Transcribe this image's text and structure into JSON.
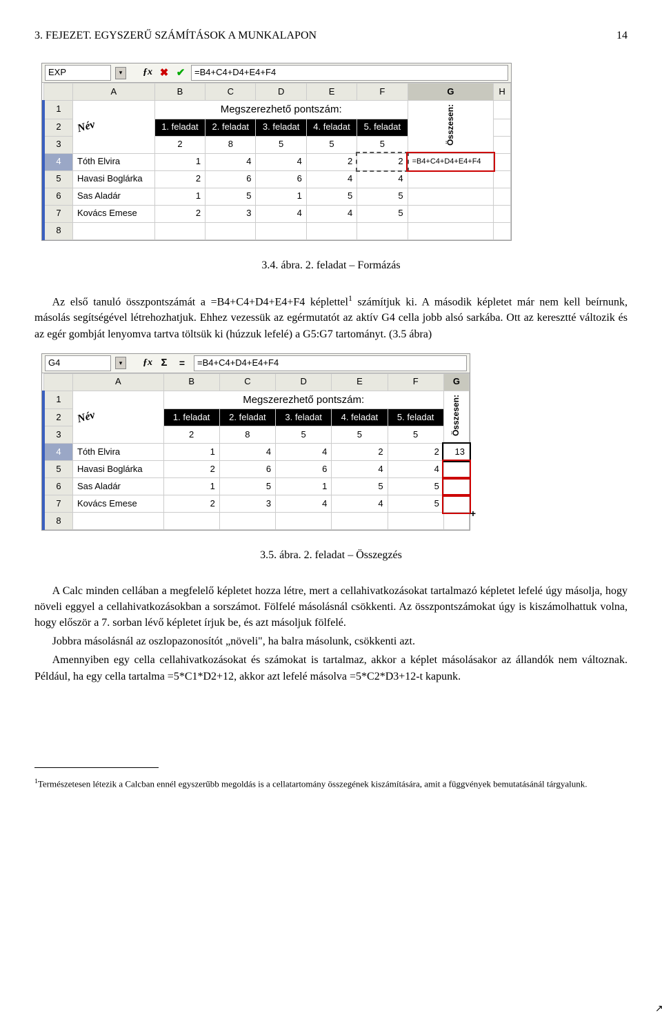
{
  "header": {
    "chapter": "3. FEJEZET. EGYSZERŰ SZÁMÍTÁSOK A MUNKALAPON",
    "page": "14"
  },
  "fig1": {
    "namebox": "EXP",
    "formula": "=B4+C4+D4+E4+F4",
    "cols": [
      "A",
      "B",
      "C",
      "D",
      "E",
      "F",
      "G",
      "H"
    ],
    "sel_col": "G",
    "rows": [
      "1",
      "2",
      "3",
      "4",
      "5",
      "6",
      "7",
      "8"
    ],
    "sel_row": "4",
    "title": "Megszerezhető pontszám:",
    "tasks": [
      "1. feladat",
      "2. feladat",
      "3. feladat",
      "4. feladat",
      "5. feladat"
    ],
    "ossz": "Összesen:",
    "nev": "Név",
    "max": [
      "2",
      "8",
      "5",
      "5",
      "5"
    ],
    "students": [
      {
        "name": "Tóth Elvira",
        "b": "1",
        "c": "4",
        "d": "4",
        "e": "2",
        "f": "2",
        "g": "=B4+C4+D4+E4+F4"
      },
      {
        "name": "Havasi Boglárka",
        "b": "2",
        "c": "6",
        "d": "6",
        "e": "4",
        "f": "4",
        "g": ""
      },
      {
        "name": "Sas Aladár",
        "b": "1",
        "c": "5",
        "d": "1",
        "e": "5",
        "f": "5",
        "g": ""
      },
      {
        "name": "Kovács Emese",
        "b": "2",
        "c": "3",
        "d": "4",
        "e": "4",
        "f": "5",
        "g": ""
      }
    ]
  },
  "cap1": "3.4. ábra. 2. feladat – Formázás",
  "para1a": "Az első tanuló összpontszámát a =B4+C4+D4+E4+F4 képlettel",
  "foot_mark": "1",
  "para1b": " számítjuk ki. A második képletet már nem kell beírnunk, másolás segítségével létrehozhatjuk. Ehhez vezessük az egérmutatót az aktív G4 cella jobb alsó sarkába. Ott az keresztté változik és az egér gombját lenyomva tartva töltsük ki (húzzuk lefelé) a G5:G7 tartományt. (3.5 ábra)",
  "fig2": {
    "namebox": "G4",
    "formula": "=B4+C4+D4+E4+F4",
    "cols": [
      "A",
      "B",
      "C",
      "D",
      "E",
      "F",
      "G"
    ],
    "sel_col": "G",
    "rows": [
      "1",
      "2",
      "3",
      "4",
      "5",
      "6",
      "7",
      "8"
    ],
    "sel_row": "4",
    "title": "Megszerezhető pontszám:",
    "tasks": [
      "1. feladat",
      "2. feladat",
      "3. feladat",
      "4. feladat",
      "5. feladat"
    ],
    "ossz": "Összesen:",
    "nev": "Név",
    "max": [
      "2",
      "8",
      "5",
      "5",
      "5"
    ],
    "students": [
      {
        "name": "Tóth Elvira",
        "b": "1",
        "c": "4",
        "d": "4",
        "e": "2",
        "f": "2",
        "g": "13"
      },
      {
        "name": "Havasi Boglárka",
        "b": "2",
        "c": "6",
        "d": "6",
        "e": "4",
        "f": "4",
        "g": ""
      },
      {
        "name": "Sas Aladár",
        "b": "1",
        "c": "5",
        "d": "1",
        "e": "5",
        "f": "5",
        "g": ""
      },
      {
        "name": "Kovács Emese",
        "b": "2",
        "c": "3",
        "d": "4",
        "e": "4",
        "f": "5",
        "g": ""
      }
    ]
  },
  "cap2": "3.5. ábra. 2. feladat – Összegzés",
  "para2": "A Calc minden cellában a megfelelő képletet hozza létre, mert a cellahivatkozásokat tartalmazó képletet lefelé úgy másolja, hogy növeli eggyel a cellahivatkozásokban a sorszámot. Fölfelé másolásnál csökkenti. Az összpontszámokat úgy is kiszámolhattuk volna, hogy először a 7. sorban lévő képletet írjuk be, és azt másoljuk fölfelé.",
  "para3": "Jobbra másolásnál az oszlopazonosítót „növeli\", ha balra másolunk, csökkenti azt.",
  "para4": "Amennyiben egy cella cellahivatkozásokat és számokat is tartalmaz, akkor a képlet másolásakor az állandók nem változnak. Például, ha egy cella tartalma =5*C1*D2+12, akkor azt lefelé másolva =5*C2*D3+12-t kapunk.",
  "footnote": "Természetesen létezik a Calcban ennél egyszerűbb megoldás is a cellatartomány összegének kiszámítására, amit a függvények bemutatásánál tárgyalunk.",
  "footnote_mark": "1"
}
